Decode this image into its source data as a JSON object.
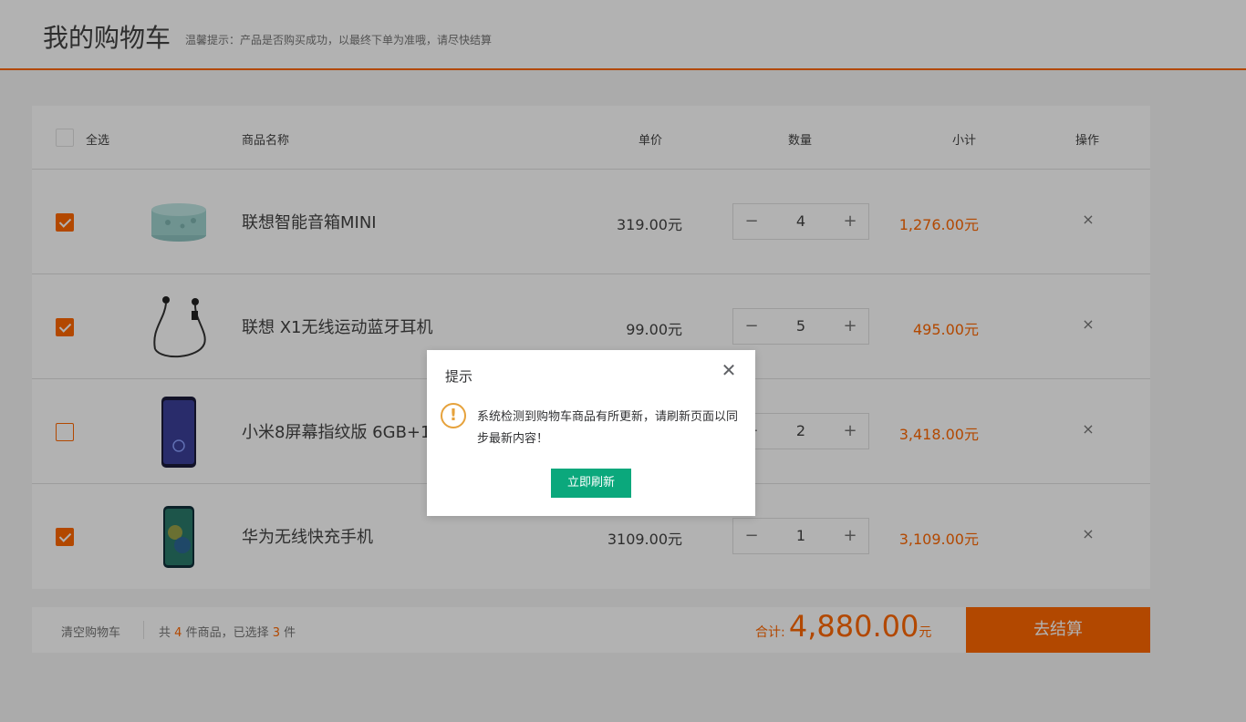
{
  "header": {
    "title": "我的购物车",
    "tip": "温馨提示：产品是否购买成功，以最终下单为准哦，请尽快结算"
  },
  "table_head": {
    "select_all": "全选",
    "name": "商品名称",
    "price": "单价",
    "qty": "数量",
    "subtotal": "小计",
    "action": "操作"
  },
  "items": [
    {
      "checked": true,
      "image": "smart-speaker-image",
      "name": "联想智能音箱MINI",
      "price": "319.00元",
      "qty": "4",
      "subtotal": "1,276.00元"
    },
    {
      "checked": true,
      "image": "earphones-image",
      "name": "联想 X1无线运动蓝牙耳机",
      "price": "99.00元",
      "qty": "5",
      "subtotal": "495.00元"
    },
    {
      "checked": false,
      "image": "phone-image",
      "name": "小米8屏幕指纹版 6GB+12",
      "price": "",
      "qty": "2",
      "subtotal": "3,418.00元"
    },
    {
      "checked": true,
      "image": "phone-image",
      "name": "华为无线快充手机",
      "price": "3109.00元",
      "qty": "1",
      "subtotal": "3,109.00元"
    }
  ],
  "qty_minus": "−",
  "qty_plus": "+",
  "delete_symbol": "×",
  "footer": {
    "clear": "清空购物车",
    "count_prefix": "共",
    "count_total": "4",
    "count_mid": "件商品，已选择",
    "count_selected": "3",
    "count_suffix": "件",
    "total_label": "合计:",
    "total_amount": "4,880.00",
    "total_unit": "元",
    "checkout": "去结算"
  },
  "modal": {
    "title": "提示",
    "close_symbol": "✕",
    "icon_symbol": "!",
    "message": "系统检测到购物车商品有所更新，请刷新页面以同步最新内容！",
    "button": "立即刷新"
  },
  "colors": {
    "accent": "#ff6700",
    "modal_button": "#0ba87c",
    "warning_icon": "#e6a23c"
  }
}
